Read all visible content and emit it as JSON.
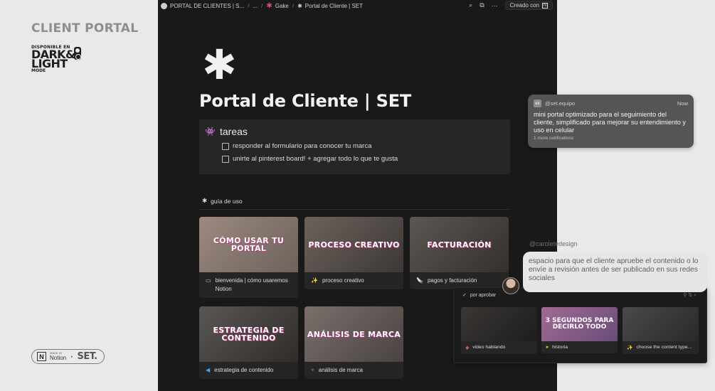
{
  "promo": {
    "title": "CLIENT PORTAL",
    "available_prefix": "DISPONIBLE EN",
    "dark_light": "DARK&",
    "light": "LIGHT",
    "mode": "MODE",
    "badge": {
      "n_letter": "N",
      "made_with": "MADE IN",
      "notion": "Notion",
      "dot": "·",
      "set": "SET."
    }
  },
  "topbar": {
    "crumbs": [
      "PORTAL DE CLIENTES | S...",
      "...",
      "Gake",
      "Portal de Cliente | SET"
    ],
    "separator": "/",
    "creado_con": "Creado con",
    "creado_n": "N",
    "icons": [
      "search-icon",
      "duplicate-icon",
      "more-icon"
    ]
  },
  "page": {
    "icon": "✱",
    "title": "Portal de Cliente | SET"
  },
  "tareas": {
    "icon": "👾",
    "title": "tareas",
    "items": [
      "responder al formulario para conocer tu marca",
      "unirte al pinterest board! + agregar todo lo que te gusta"
    ]
  },
  "guide": {
    "icon": "✱",
    "label": "guía de uso"
  },
  "cards": [
    {
      "image_text": "CÓMO USAR TU PORTAL",
      "icon": "▭",
      "caption": "bienvenida | cómo usaremos Notion",
      "bg": "#8a7c72"
    },
    {
      "image_text": "PROCESO CREATIVO",
      "icon": "✨",
      "caption": "proceso creativo",
      "bg": "#5b5450"
    },
    {
      "image_text": "FACTURACIÓN",
      "icon": "🪚",
      "caption": "pagos y facturación",
      "bg": "#4a4744"
    },
    {
      "image_text": "ESTRATEGIA DE CONTENIDO",
      "icon": "◀",
      "caption": "estrategia de contenido",
      "bg": "#4d4a47"
    },
    {
      "image_text": "ANÁLISIS DE MARCA",
      "icon": "♥",
      "caption": "análisis de marca",
      "bg": "#6a6260"
    }
  ],
  "notification": {
    "icon_text": "ex",
    "sender": "@set.equipo",
    "time": "Now",
    "body": "mini portal optimizado para el seguimiento del cliente, simplificado para mejorar su entendimiento y uso en celular",
    "more": "1 more notifications"
  },
  "comment": {
    "handle": "@caroletedesign",
    "text": "espacio para que el cliente apruebe el contenido o lo envíe a revisión antes de ser publicado en sus redes sociales"
  },
  "board": {
    "check": "✓",
    "label": "por aprobar",
    "tools": "⚲ ⇅ ⌕",
    "cards": [
      {
        "image_text": "",
        "icon": "◆",
        "caption": "video hablando",
        "bg": "#2e2c2b"
      },
      {
        "image_text": "3 SEGUNDOS PARA DECIRLO TODO",
        "icon": "●",
        "caption": "historia",
        "bg": "#8d5e86"
      },
      {
        "image_text": "",
        "icon": "✨",
        "caption": "choose the content type...",
        "bg": "#3c3b3a"
      }
    ]
  }
}
